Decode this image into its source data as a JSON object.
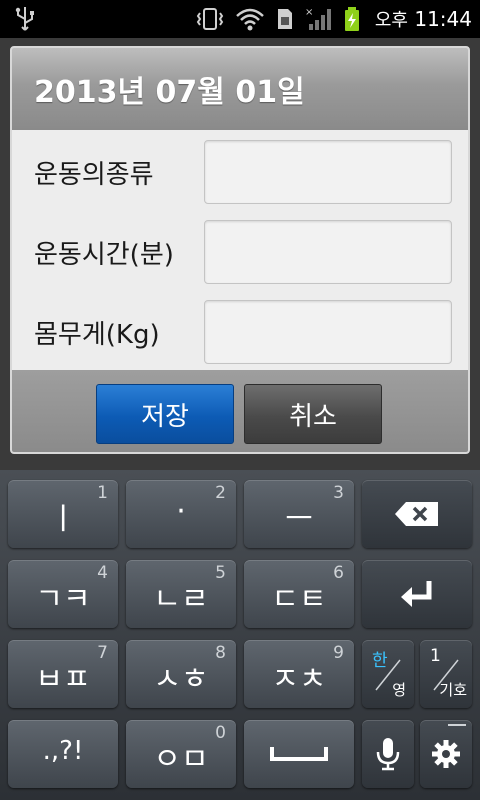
{
  "status_bar": {
    "ampm": "오후",
    "time": "11:44"
  },
  "dialog": {
    "title": "2013년 07월 01일",
    "fields": [
      {
        "label": "운동의종류",
        "value": ""
      },
      {
        "label": "운동시간(분)",
        "value": ""
      },
      {
        "label": "몸무게(Kg)",
        "value": ""
      }
    ],
    "save_label": "저장",
    "cancel_label": "취소"
  },
  "keyboard": {
    "row1": [
      {
        "main": "ㅣ",
        "num": "1"
      },
      {
        "main": "·",
        "num": "2"
      },
      {
        "main": "ㅡ",
        "num": "3"
      }
    ],
    "row2": [
      {
        "main": "ㄱㅋ",
        "num": "4"
      },
      {
        "main": "ㄴㄹ",
        "num": "5"
      },
      {
        "main": "ㄷㅌ",
        "num": "6"
      }
    ],
    "row3": [
      {
        "main": "ㅂㅍ",
        "num": "7"
      },
      {
        "main": "ㅅㅎ",
        "num": "8"
      },
      {
        "main": "ㅈㅊ",
        "num": "9"
      }
    ],
    "row4": [
      {
        "main": ".,?!",
        "num": ""
      },
      {
        "main": "ㅇㅁ",
        "num": "0"
      }
    ],
    "lang_key": {
      "top": "한",
      "bottom": "영"
    },
    "symbol_key": {
      "top": "1",
      "bottom": "기호"
    }
  }
}
